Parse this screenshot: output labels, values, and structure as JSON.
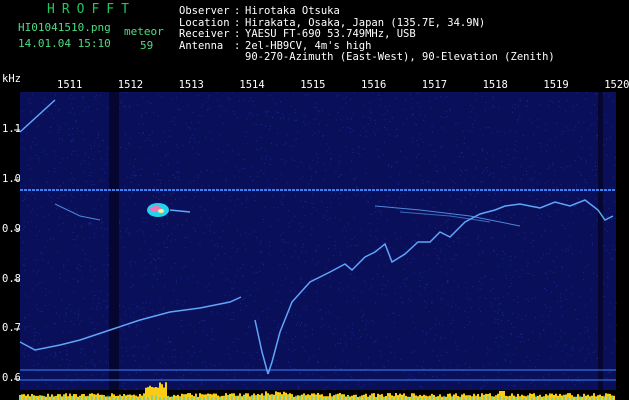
{
  "header": {
    "title": "HROFFT",
    "filename": "HI01041510.png",
    "datetime": "14.01.04 15:10",
    "meteor_label": "meteor",
    "meteor_count": "59"
  },
  "info": [
    {
      "label": "Observer",
      "sep": ":",
      "value": "Hirotaka Otsuka"
    },
    {
      "label": "Location",
      "sep": ":",
      "value": "Hirakata, Osaka, Japan (135.7E, 34.9N)"
    },
    {
      "label": "Receiver",
      "sep": ":",
      "value": "YAESU FT-690 53.749MHz, USB"
    },
    {
      "label": "Antenna",
      "sep": ":",
      "value": "2el-HB9CV, 4m's high"
    },
    {
      "label": "",
      "sep": "",
      "value": "90-270-Azimuth (East-West), 90-Elevation (Zenith)"
    }
  ],
  "axis": {
    "unit": "kHz",
    "time_ticks": [
      "1511",
      "1512",
      "1513",
      "1514",
      "1515",
      "1516",
      "1517",
      "1518",
      "1519",
      "1520"
    ],
    "freq_ticks": [
      "1.1",
      "1.0",
      "0.9",
      "0.8",
      "0.7",
      "0.6"
    ]
  },
  "colors": {
    "background": "#000000",
    "noise": "#0a0f5a",
    "signal": "#60a5fa",
    "reference_line": "#3b82f6",
    "level_bar": "#facc15",
    "title": "#22c55e"
  }
}
